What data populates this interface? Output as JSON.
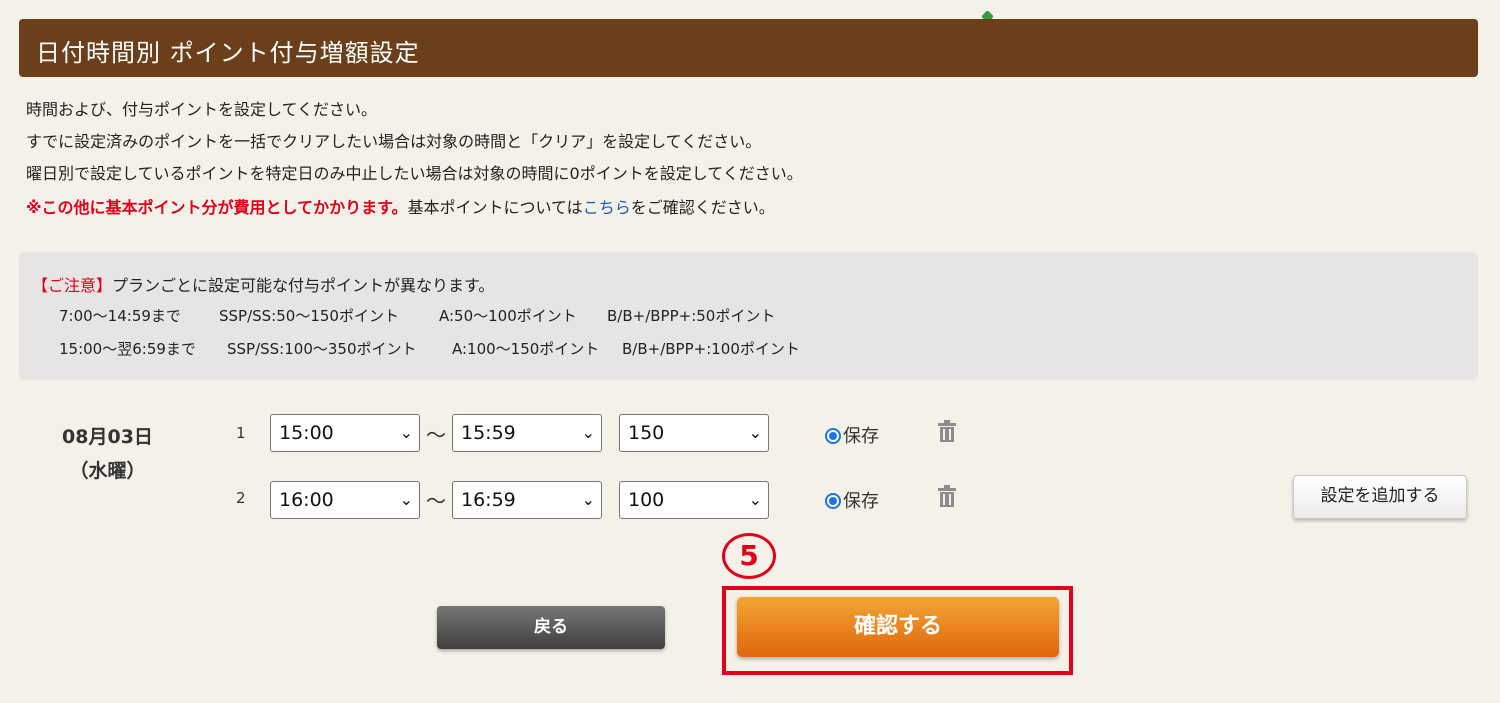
{
  "header": {
    "title": "日付時間別 ポイント付与増額設定"
  },
  "description": {
    "line1": "時間および、付与ポイントを設定してください。",
    "line2": "すでに設定済みのポイントを一括でクリアしたい場合は対象の時間と「クリア」を設定してください。",
    "line3": "曜日別で設定しているポイントを特定日のみ中止したい場合は対象の時間に0ポイントを設定してください。",
    "warning_strong": "※この他に基本ポイント分が費用としてかかります。",
    "warning_text_before_link": "基本ポイントについては",
    "warning_link": "こちら",
    "warning_text_after_link": "をご確認ください。"
  },
  "notice": {
    "label": "【ご注意】",
    "text": "プランごとに設定可能な付与ポイントが異なります。",
    "rows": [
      {
        "time": "7:00〜14:59まで",
        "ssp": "SSP/SS:50〜150ポイント",
        "a": "A:50〜100ポイント",
        "b": "B/B+/BPP+:50ポイント"
      },
      {
        "time": "15:00〜翌6:59まで",
        "ssp": "SSP/SS:100〜350ポイント",
        "a": "A:100〜150ポイント",
        "b": "B/B+/BPP+:100ポイント"
      }
    ]
  },
  "schedule": {
    "date": "08月03日",
    "weekday": "（水曜）",
    "tilde": "〜",
    "rows": [
      {
        "num": "1",
        "start": "15:00",
        "end": "15:59",
        "points": "150",
        "save_label": "保存"
      },
      {
        "num": "2",
        "start": "16:00",
        "end": "16:59",
        "points": "100",
        "save_label": "保存"
      }
    ],
    "add_button": "設定を追加する"
  },
  "annotation": {
    "step": "5"
  },
  "actions": {
    "back": "戻る",
    "confirm": "確認する"
  },
  "colors": {
    "header_bg": "#6b3f19",
    "accent_red": "#e0001b",
    "confirm_orange": "#e0660d",
    "link_blue": "#1a58c2"
  }
}
